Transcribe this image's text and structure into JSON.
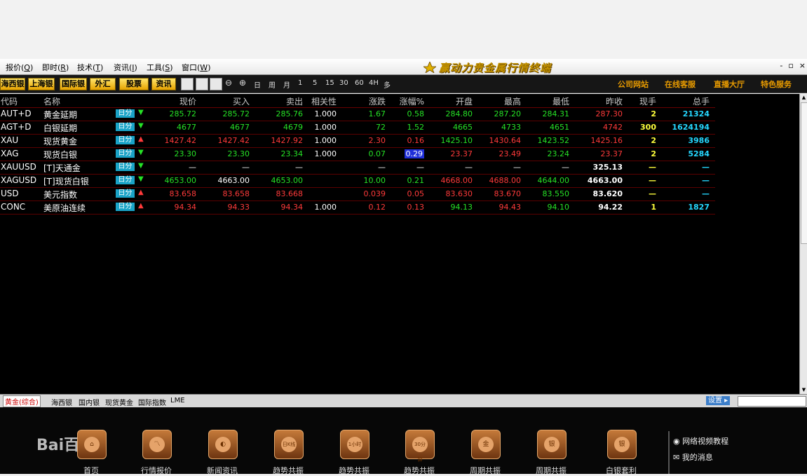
{
  "menu": {
    "items": [
      {
        "label": "报价",
        "acc": "Q"
      },
      {
        "label": "即时",
        "acc": "R"
      },
      {
        "label": "技术",
        "acc": "T"
      },
      {
        "label": "资讯",
        "acc": "I"
      },
      {
        "label": "工具",
        "acc": "S"
      },
      {
        "label": "窗口",
        "acc": "W"
      }
    ],
    "app_title": "赢动力贵金属行情终端",
    "window_controls": [
      "-",
      "▫",
      "×"
    ]
  },
  "toolbar": {
    "buttons": [
      "海西银",
      "上海银",
      "国际银",
      "外汇",
      "股票",
      "资讯"
    ],
    "periods": [
      "日",
      "周",
      "月",
      "1",
      "5",
      "15",
      "30",
      "60",
      "4H",
      "多"
    ],
    "links": [
      "公司网站",
      "在线客服",
      "直播大厅",
      "特色服务"
    ]
  },
  "table": {
    "headers": [
      "代码",
      "名称",
      "现价",
      "买入",
      "卖出",
      "相关性",
      "涨跌",
      "涨幅%",
      "开盘",
      "最高",
      "最低",
      "昨收",
      "现手",
      "总手"
    ],
    "tag_label": "日分",
    "rows": [
      {
        "code": "AUT+D",
        "name": "黄金延期",
        "dir": "down",
        "price": "285.72",
        "buy": "285.72",
        "sell": "285.76",
        "corr": "1.000",
        "chg": "1.67",
        "pct": "0.58",
        "open": "284.80",
        "high": "287.20",
        "low": "284.31",
        "prev": "287.30",
        "vol": "2",
        "total": "21324",
        "colors": {
          "price": "g",
          "buy": "g",
          "sell": "g",
          "chg": "g",
          "pct": "g",
          "open": "g",
          "high": "g",
          "low": "g",
          "prev": "r"
        }
      },
      {
        "code": "AGT+D",
        "name": "白银延期",
        "dir": "down",
        "price": "4677",
        "buy": "4677",
        "sell": "4679",
        "corr": "1.000",
        "chg": "72",
        "pct": "1.52",
        "open": "4665",
        "high": "4733",
        "low": "4651",
        "prev": "4742",
        "vol": "300",
        "total": "1624194",
        "colors": {
          "price": "g",
          "buy": "g",
          "sell": "g",
          "chg": "g",
          "pct": "g",
          "open": "g",
          "high": "g",
          "low": "g",
          "prev": "r"
        }
      },
      {
        "code": "XAU",
        "name": "现货黄金",
        "dir": "up",
        "price": "1427.42",
        "buy": "1427.42",
        "sell": "1427.92",
        "corr": "1.000",
        "chg": "2.30",
        "pct": "0.16",
        "open": "1425.10",
        "high": "1430.64",
        "low": "1423.52",
        "prev": "1425.16",
        "vol": "2",
        "total": "3986",
        "colors": {
          "price": "r",
          "buy": "r",
          "sell": "r",
          "chg": "r",
          "pct": "r",
          "open": "g",
          "high": "r",
          "low": "g",
          "prev": "r"
        }
      },
      {
        "code": "XAG",
        "name": "现货白银",
        "dir": "down",
        "price": "23.30",
        "buy": "23.30",
        "sell": "23.34",
        "corr": "1.000",
        "chg": "0.07",
        "pct": "0.29",
        "open": "23.37",
        "high": "23.49",
        "low": "23.24",
        "prev": "23.37",
        "vol": "2",
        "total": "5284",
        "colors": {
          "price": "g",
          "buy": "g",
          "sell": "g",
          "chg": "g",
          "pct": "sel",
          "open": "r",
          "high": "r",
          "low": "g",
          "prev": "r"
        }
      },
      {
        "code": "XAUUSD",
        "name": "[T]天通金",
        "dir": "down",
        "price": "—",
        "buy": "—",
        "sell": "—",
        "corr": "",
        "chg": "—",
        "pct": "—",
        "open": "—",
        "high": "—",
        "low": "—",
        "prev": "325.13",
        "vol": "—",
        "total": "—",
        "colors": {
          "price": "w",
          "buy": "w",
          "sell": "w",
          "chg": "w",
          "pct": "w",
          "open": "w",
          "high": "w",
          "low": "w",
          "prev": "w"
        }
      },
      {
        "code": "XAGUSD",
        "name": "[T]现货白银",
        "dir": "down",
        "price": "4653.00",
        "buy": "4663.00",
        "sell": "4653.00",
        "corr": "",
        "chg": "10.00",
        "pct": "0.21",
        "open": "4668.00",
        "high": "4688.00",
        "low": "4644.00",
        "prev": "4663.00",
        "vol": "—",
        "total": "—",
        "colors": {
          "price": "g",
          "buy": "w",
          "sell": "g",
          "chg": "g",
          "pct": "g",
          "open": "r",
          "high": "r",
          "low": "g",
          "prev": "w"
        }
      },
      {
        "code": "USD",
        "name": "美元指数",
        "dir": "up",
        "price": "83.658",
        "buy": "83.658",
        "sell": "83.668",
        "corr": "",
        "chg": "0.039",
        "pct": "0.05",
        "open": "83.630",
        "high": "83.670",
        "low": "83.550",
        "prev": "83.620",
        "vol": "—",
        "total": "—",
        "colors": {
          "price": "r",
          "buy": "r",
          "sell": "r",
          "chg": "r",
          "pct": "r",
          "open": "r",
          "high": "r",
          "low": "g",
          "prev": "w"
        }
      },
      {
        "code": "CONC",
        "name": "美原油连续",
        "dir": "up",
        "price": "94.34",
        "buy": "94.33",
        "sell": "94.34",
        "corr": "1.000",
        "chg": "0.12",
        "pct": "0.13",
        "open": "94.13",
        "high": "94.43",
        "low": "94.10",
        "prev": "94.22",
        "vol": "1",
        "total": "1827",
        "colors": {
          "price": "r",
          "buy": "r",
          "sell": "r",
          "chg": "r",
          "pct": "r",
          "open": "g",
          "high": "r",
          "low": "g",
          "prev": "w"
        }
      }
    ]
  },
  "tabs": [
    "黄金(综合)",
    "海西银",
    "国内银",
    "现货黄金",
    "国际指数",
    "LME"
  ],
  "settings_label": "设置",
  "bottom": {
    "watermark": "Bai百科",
    "icons": [
      {
        "label": "首页",
        "glyph": "⌂"
      },
      {
        "label": "行情报价",
        "glyph": "〽"
      },
      {
        "label": "新闻资讯",
        "glyph": "◐"
      },
      {
        "label": "趋势共振",
        "glyph": "日K线"
      },
      {
        "label": "趋势共振",
        "glyph": "1小时"
      },
      {
        "label": "趋势共振",
        "glyph": "30分钟"
      },
      {
        "label": "周期共振",
        "glyph": "金"
      },
      {
        "label": "周期共振",
        "glyph": "银"
      },
      {
        "label": "白银套利",
        "glyph": "银"
      }
    ],
    "right_links": [
      "网络视频教程",
      "我的消息"
    ]
  },
  "colors": {
    "g": "#26e226",
    "r": "#ff3a3a",
    "w": "#ffffff",
    "gold": "#e89b00",
    "cyan": "#25d7ff",
    "yellow": "#ffff3c"
  }
}
